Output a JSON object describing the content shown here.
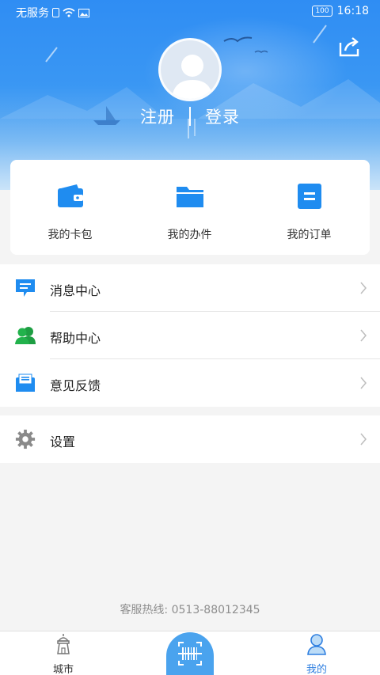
{
  "status_bar": {
    "carrier": "无服务",
    "battery": "100",
    "time": "16:18"
  },
  "header": {
    "register_label": "注册",
    "login_label": "登录"
  },
  "quick_actions": [
    {
      "label": "我的卡包",
      "icon": "wallet-icon"
    },
    {
      "label": "我的办件",
      "icon": "folder-icon"
    },
    {
      "label": "我的订单",
      "icon": "order-icon"
    }
  ],
  "menu": {
    "group1": [
      {
        "label": "消息中心",
        "icon": "message-icon"
      },
      {
        "label": "帮助中心",
        "icon": "users-icon"
      },
      {
        "label": "意见反馈",
        "icon": "mail-icon"
      }
    ],
    "group2": [
      {
        "label": "设置",
        "icon": "gear-icon"
      }
    ]
  },
  "hotline": "客服热线: 0513-88012345",
  "bottom_nav": {
    "city_label": "城市",
    "mine_label": "我的"
  },
  "colors": {
    "primary_blue": "#2f8df3",
    "icon_blue": "#1f8cf0",
    "help_green": "#22b24c",
    "active_tab": "#2f7fe0"
  }
}
